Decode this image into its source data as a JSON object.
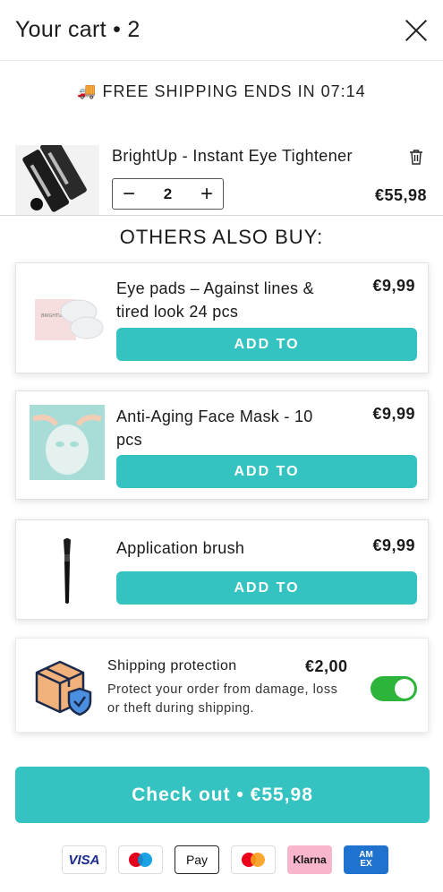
{
  "header": {
    "title": "Your cart • 2"
  },
  "banner": {
    "icon": "truck-icon",
    "text": "FREE SHIPPING ENDS IN 07:14"
  },
  "cart_item": {
    "name": "BrightUp - Instant Eye Tightener",
    "quantity": "2",
    "price": "€55,98",
    "minus": "−",
    "plus": "+"
  },
  "upsell": {
    "title": "OTHERS ALSO BUY:",
    "items": [
      {
        "name": "Eye pads – Against lines & tired look 24 pcs",
        "price": "€9,99",
        "button": "ADD TO",
        "image_text": "BRIGHTUP"
      },
      {
        "name": "Anti-Aging Face Mask - 10 pcs",
        "price": "€9,99",
        "button": "ADD TO"
      },
      {
        "name": "Application brush",
        "price": "€9,99",
        "button": "ADD TO"
      }
    ]
  },
  "protection": {
    "title": "Shipping protection",
    "price": "€2,00",
    "description": "Protect your order from damage, loss or theft during shipping.",
    "enabled": true
  },
  "checkout": {
    "label": "Check out • €55,98"
  },
  "payments": [
    "VISA",
    "Maestro",
    "Apple Pay",
    "Mastercard",
    "Klarna",
    "American Express"
  ],
  "colors": {
    "accent": "#35c3c1",
    "toggle_on": "#2cb53a"
  }
}
